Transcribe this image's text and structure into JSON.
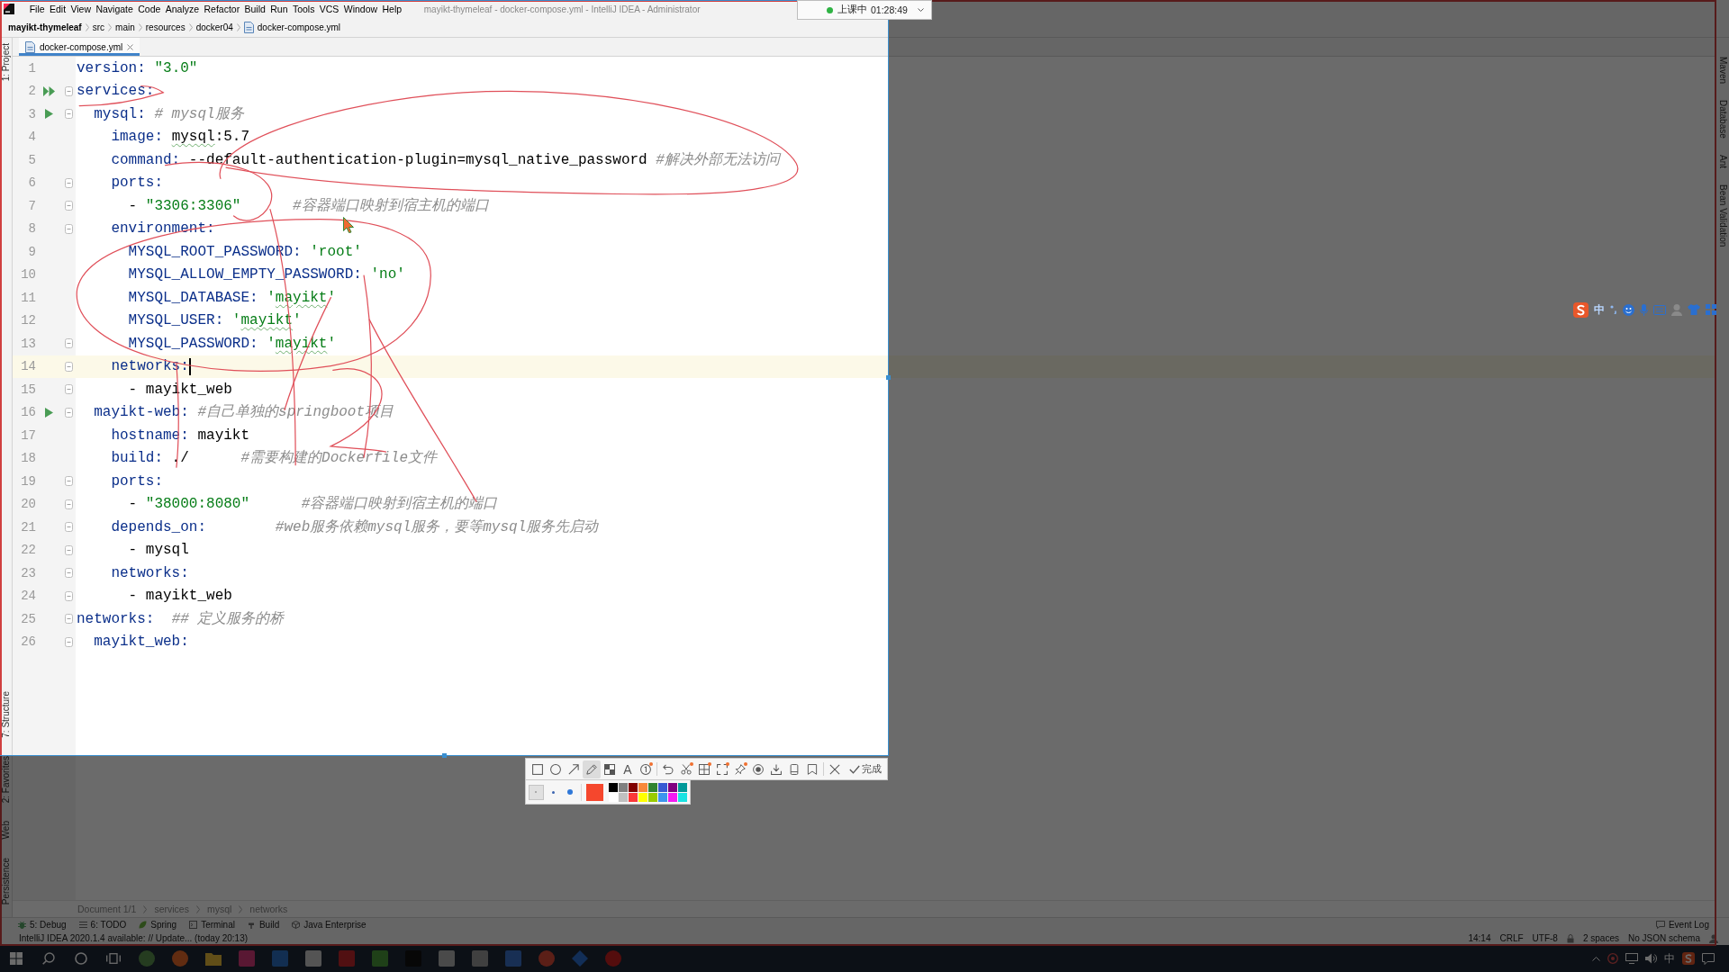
{
  "menu_bar": {
    "items": [
      "File",
      "Edit",
      "View",
      "Navigate",
      "Code",
      "Analyze",
      "Refactor",
      "Build",
      "Run",
      "Tools",
      "VCS",
      "Window",
      "Help"
    ],
    "title": "mayikt-thymeleaf - docker-compose.yml - IntelliJ IDEA - Administrator"
  },
  "recorder": {
    "status": "上课中",
    "time": "01:28:49"
  },
  "breadcrumb": [
    "mayikt-thymeleaf",
    "src",
    "main",
    "resources",
    "docker04",
    "docker-compose.yml"
  ],
  "left_tool_strip": {
    "top": [
      "1: Project"
    ],
    "bottom": [
      "7: Structure",
      "2: Favorites",
      "Web",
      "Persistence"
    ]
  },
  "tabs": [
    {
      "label": "docker-compose.yml",
      "selected": true
    }
  ],
  "editor": {
    "lines": [
      {
        "number": "1",
        "fold": false,
        "current": false,
        "segments": [
          {
            "kind": "key",
            "text": "version: "
          },
          {
            "kind": "string",
            "text": "\"3.0\""
          }
        ]
      },
      {
        "number": "2",
        "fold": true,
        "current": false,
        "gutter_marker": {
          "kind": "run_all"
        },
        "segments": [
          {
            "kind": "key",
            "text": "services:"
          }
        ]
      },
      {
        "number": "3",
        "fold": true,
        "current": false,
        "gutter_marker": {
          "kind": "run"
        },
        "segments": [
          {
            "kind": "key",
            "text": "  mysql:"
          },
          {
            "kind": "comment",
            "text": " # mysql服务"
          }
        ]
      },
      {
        "number": "4",
        "fold": false,
        "current": false,
        "segments": [
          {
            "kind": "key",
            "text": "    image: "
          },
          {
            "kind": "typo_plain",
            "text": "mysql"
          },
          {
            "kind": "plain",
            "text": ":5.7"
          }
        ]
      },
      {
        "number": "5",
        "fold": false,
        "current": false,
        "segments": [
          {
            "kind": "key",
            "text": "    command:"
          },
          {
            "kind": "plain",
            "text": " --default-authentication-plugin=mysql_native_password"
          },
          {
            "kind": "comment",
            "text": " #解决外部无法访问"
          }
        ]
      },
      {
        "number": "6",
        "fold": true,
        "current": false,
        "segments": [
          {
            "kind": "key",
            "text": "    ports:"
          }
        ]
      },
      {
        "number": "7",
        "fold": true,
        "current": false,
        "segments": [
          {
            "kind": "plain",
            "text": "      - "
          },
          {
            "kind": "string",
            "text": "\"3306:3306\""
          },
          {
            "kind": "comment",
            "text": "      #容器端口映射到宿主机的端口"
          }
        ]
      },
      {
        "number": "8",
        "fold": true,
        "current": false,
        "segments": [
          {
            "kind": "key",
            "text": "    environment:"
          }
        ]
      },
      {
        "number": "9",
        "fold": false,
        "current": false,
        "segments": [
          {
            "kind": "key",
            "text": "      MYSQL_ROOT_PASSWORD: "
          },
          {
            "kind": "string",
            "text": "'root'"
          }
        ]
      },
      {
        "number": "10",
        "fold": false,
        "current": false,
        "segments": [
          {
            "kind": "key",
            "text": "      MYSQL_ALLOW_EMPTY_PASSWORD: "
          },
          {
            "kind": "string",
            "text": "'no'"
          }
        ]
      },
      {
        "number": "11",
        "fold": false,
        "current": false,
        "segments": [
          {
            "kind": "key",
            "text": "      MYSQL_DATABASE:"
          },
          {
            "kind": "string",
            "text": " '"
          },
          {
            "kind": "typo_string",
            "text": "mayikt"
          },
          {
            "kind": "string",
            "text": "'"
          }
        ]
      },
      {
        "number": "12",
        "fold": false,
        "current": false,
        "segments": [
          {
            "kind": "key",
            "text": "      MYSQL_USER:"
          },
          {
            "kind": "string",
            "text": " '"
          },
          {
            "kind": "typo_string",
            "text": "mayikt"
          },
          {
            "kind": "string",
            "text": "'"
          }
        ]
      },
      {
        "number": "13",
        "fold": true,
        "current": false,
        "segments": [
          {
            "kind": "key",
            "text": "      MYSQL_PASSWORD:"
          },
          {
            "kind": "string",
            "text": " '"
          },
          {
            "kind": "typo_string",
            "text": "mayikt"
          },
          {
            "kind": "string",
            "text": "'"
          }
        ]
      },
      {
        "number": "14",
        "fold": true,
        "current": true,
        "segments": [
          {
            "kind": "key",
            "text": "    networks:"
          }
        ]
      },
      {
        "number": "15",
        "fold": true,
        "current": false,
        "segments": [
          {
            "kind": "plain",
            "text": "      - mayikt_web"
          }
        ]
      },
      {
        "number": "16",
        "fold": true,
        "current": false,
        "gutter_marker": {
          "kind": "run"
        },
        "segments": [
          {
            "kind": "key",
            "text": "  mayikt-web:"
          },
          {
            "kind": "comment",
            "text": " #自己单独的springboot项目"
          }
        ]
      },
      {
        "number": "17",
        "fold": false,
        "current": false,
        "segments": [
          {
            "kind": "key",
            "text": "    hostname:"
          },
          {
            "kind": "plain",
            "text": " mayikt"
          }
        ]
      },
      {
        "number": "18",
        "fold": false,
        "current": false,
        "segments": [
          {
            "kind": "key",
            "text": "    build:"
          },
          {
            "kind": "plain",
            "text": " ./"
          },
          {
            "kind": "comment",
            "text": "      #需要构建的Dockerfile文件"
          }
        ]
      },
      {
        "number": "19",
        "fold": true,
        "current": false,
        "segments": [
          {
            "kind": "key",
            "text": "    ports:"
          }
        ]
      },
      {
        "number": "20",
        "fold": true,
        "current": false,
        "segments": [
          {
            "kind": "plain",
            "text": "      - "
          },
          {
            "kind": "string",
            "text": "\"38000:8080\""
          },
          {
            "kind": "comment",
            "text": "      #容器端口映射到宿主机的端口"
          }
        ]
      },
      {
        "number": "21",
        "fold": true,
        "current": false,
        "segments": [
          {
            "kind": "key",
            "text": "    depends_on:"
          },
          {
            "kind": "comment",
            "text": "        #web服务依赖mysql服务，要等mysql服务先启动"
          }
        ]
      },
      {
        "number": "22",
        "fold": true,
        "current": false,
        "segments": [
          {
            "kind": "plain",
            "text": "      - mysql"
          }
        ]
      },
      {
        "number": "23",
        "fold": true,
        "current": false,
        "segments": [
          {
            "kind": "key",
            "text": "    networks:"
          }
        ]
      },
      {
        "number": "24",
        "fold": true,
        "current": false,
        "segments": [
          {
            "kind": "plain",
            "text": "      - mayikt_web"
          }
        ]
      },
      {
        "number": "25",
        "fold": true,
        "current": false,
        "segments": [
          {
            "kind": "key",
            "text": "networks:"
          },
          {
            "kind": "comment",
            "text": "  ## 定义服务的桥"
          }
        ]
      },
      {
        "number": "26",
        "fold": true,
        "current": false,
        "segments": [
          {
            "kind": "key",
            "text": "  mayikt_web:"
          }
        ]
      }
    ]
  },
  "editor_breadcrumb": [
    "Document 1/1",
    "services",
    "mysql",
    "networks"
  ],
  "right_tool_strip": [
    "Maven",
    "Database",
    "Ant",
    "Bean Validation"
  ],
  "ime_bar": {
    "mode": "中"
  },
  "screenshot_toolbar": {
    "tools": [
      {
        "kind": "rectangle",
        "selected": false,
        "badge": false
      },
      {
        "kind": "ellipse",
        "selected": false,
        "badge": false
      },
      {
        "kind": "arrow",
        "selected": false,
        "badge": false
      },
      {
        "kind": "pen",
        "selected": true,
        "badge": false
      },
      {
        "kind": "mosaic",
        "selected": false,
        "badge": false
      },
      {
        "kind": "text",
        "glyph": "A",
        "selected": false,
        "badge": false
      },
      {
        "kind": "counter",
        "selected": false,
        "badge": true
      }
    ],
    "actions": [
      {
        "kind": "undo",
        "badge": false
      },
      {
        "kind": "scissors",
        "badge": true
      },
      {
        "kind": "grid",
        "badge": true
      },
      {
        "kind": "expand",
        "badge": true
      },
      {
        "kind": "pin",
        "badge": true
      },
      {
        "kind": "record",
        "badge": false
      },
      {
        "kind": "download",
        "badge": false
      },
      {
        "kind": "device",
        "badge": false
      },
      {
        "kind": "bookmark",
        "badge": false
      },
      {
        "kind": "close",
        "badge": false
      }
    ],
    "done": {
      "label": "完成"
    },
    "brush_sizes": [
      {
        "selected": true
      },
      {
        "selected": false
      },
      {
        "selected": false
      }
    ],
    "current": {
      "color": "#f5472d"
    },
    "palette": [
      {
        "color": "#000000"
      },
      {
        "color": "#808080"
      },
      {
        "color": "#800000"
      },
      {
        "color": "#f7883a"
      },
      {
        "color": "#308430"
      },
      {
        "color": "#385ad3"
      },
      {
        "color": "#800080"
      },
      {
        "color": "#009999"
      },
      {
        "color": "#ffffff"
      },
      {
        "color": "#c0c0c0"
      },
      {
        "color": "#fb3838"
      },
      {
        "color": "#ffff00"
      },
      {
        "color": "#99cc00"
      },
      {
        "color": "#3d95ee"
      },
      {
        "color": "#f31bf3"
      },
      {
        "color": "#19e3e3"
      }
    ]
  },
  "tool_windows": [
    {
      "label": "5: Debug",
      "kind": "debug"
    },
    {
      "label": "6: TODO",
      "kind": "todo"
    },
    {
      "label": "Spring",
      "kind": "spring"
    },
    {
      "label": "Terminal",
      "kind": "terminal"
    },
    {
      "label": "Build",
      "kind": "build"
    },
    {
      "label": "Java Enterprise",
      "kind": "enterprise"
    }
  ],
  "event_log": "Event Log",
  "status_bar": {
    "message": "IntelliJ IDEA 2020.1.4 available: // Update... (today 20:13)",
    "position": "14:14",
    "line_separator": "CRLF",
    "encoding": "UTF-8",
    "indent": "2 spaces",
    "schema": "No JSON schema"
  },
  "taskbar": {
    "tray_ime": "中"
  }
}
